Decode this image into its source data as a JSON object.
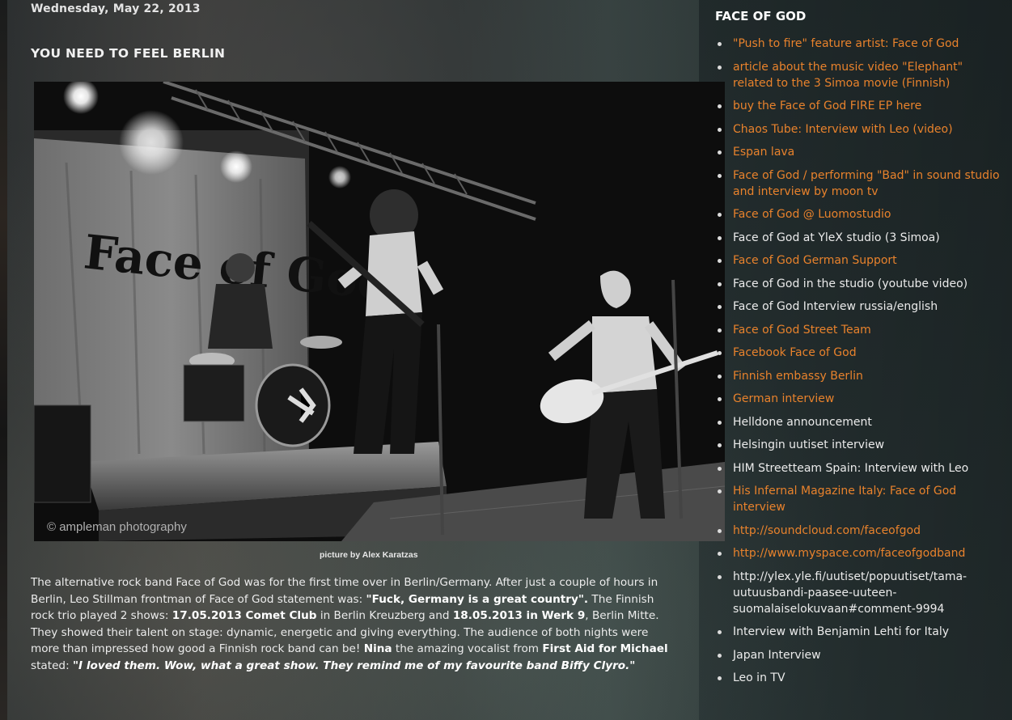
{
  "post": {
    "date": "Wednesday, May 22, 2013",
    "title": "YOU NEED TO FEEL BERLIN",
    "photo": {
      "banner_text": "Face of God",
      "watermark": "© ampleman photography",
      "caption": "picture by Alex Karatzas"
    },
    "body": {
      "p1": "The alternative rock band Face of God was for the first time over in Berlin/Germany. After just a couple of hours in Berlin, Leo Stillman frontman of Face of God statement was: ",
      "quote1": "\"Fuck, Germany is a great country\".",
      "p2": "  The Finnish rock trio played 2 shows: ",
      "show1": "17.05.2013 Comet Club",
      "p3": " in Berlin Kreuzberg and ",
      "show2": "18.05.2013 in Werk 9",
      "p4": ", Berlin Mitte. They showed their talent on stage: dynamic, energetic and giving everything. The audience of both nights were more than impressed how good a Finnish rock band can be! ",
      "nina": "Nina",
      "p5": " the amazing vocalist from ",
      "band": "First Aid for Michael",
      "p6": " stated: ",
      "quote2": "\"I loved them. Wow, what a great show. They remind me of my favourite band Biffy Clyro.\""
    }
  },
  "sidebar": {
    "title": "FACE OF GOD",
    "links_color": "#e8822c",
    "items": [
      {
        "label": "\"Push to fire\" feature artist: Face of God",
        "link": true
      },
      {
        "label": "article about the music video \"Elephant\" related to the 3 Simoa movie (Finnish)",
        "link": true
      },
      {
        "label": "buy the Face of God FIRE EP here",
        "link": true
      },
      {
        "label": "Chaos Tube: Interview with Leo (video)",
        "link": true
      },
      {
        "label": "Espan lava",
        "link": true
      },
      {
        "label": "Face of God / performing \"Bad\" in sound studio and interview by moon tv",
        "link": true
      },
      {
        "label": "Face of God @ Luomostudio",
        "link": true
      },
      {
        "label": "Face of God at YleX studio (3 Simoa)",
        "link": false
      },
      {
        "label": "Face of God German Support",
        "link": true
      },
      {
        "label": "Face of God in the studio (youtube video)",
        "link": false
      },
      {
        "label": "Face of God Interview russia/english",
        "link": false
      },
      {
        "label": "Face of God Street Team",
        "link": true
      },
      {
        "label": "Facebook Face of God",
        "link": true
      },
      {
        "label": "Finnish embassy Berlin",
        "link": true
      },
      {
        "label": "German interview",
        "link": true
      },
      {
        "label": "Helldone announcement",
        "link": false
      },
      {
        "label": "Helsingin uutiset interview",
        "link": false
      },
      {
        "label": "HIM Streetteam Spain: Interview with Leo",
        "link": false
      },
      {
        "label": "His Infernal Magazine Italy: Face of God interview",
        "link": true
      },
      {
        "label": "http://soundcloud.com/faceofgod",
        "link": true
      },
      {
        "label": "http://www.myspace.com/faceofgodband",
        "link": true
      },
      {
        "label": "http://ylex.yle.fi/uutiset/popuutiset/tama-uutuusbandi-paasee-uuteen-suomalaiselokuvaan#comment-9994",
        "link": false
      },
      {
        "label": "Interview with Benjamin Lehti for Italy",
        "link": false
      },
      {
        "label": "Japan Interview",
        "link": false
      },
      {
        "label": "Leo in TV",
        "link": false
      }
    ]
  }
}
